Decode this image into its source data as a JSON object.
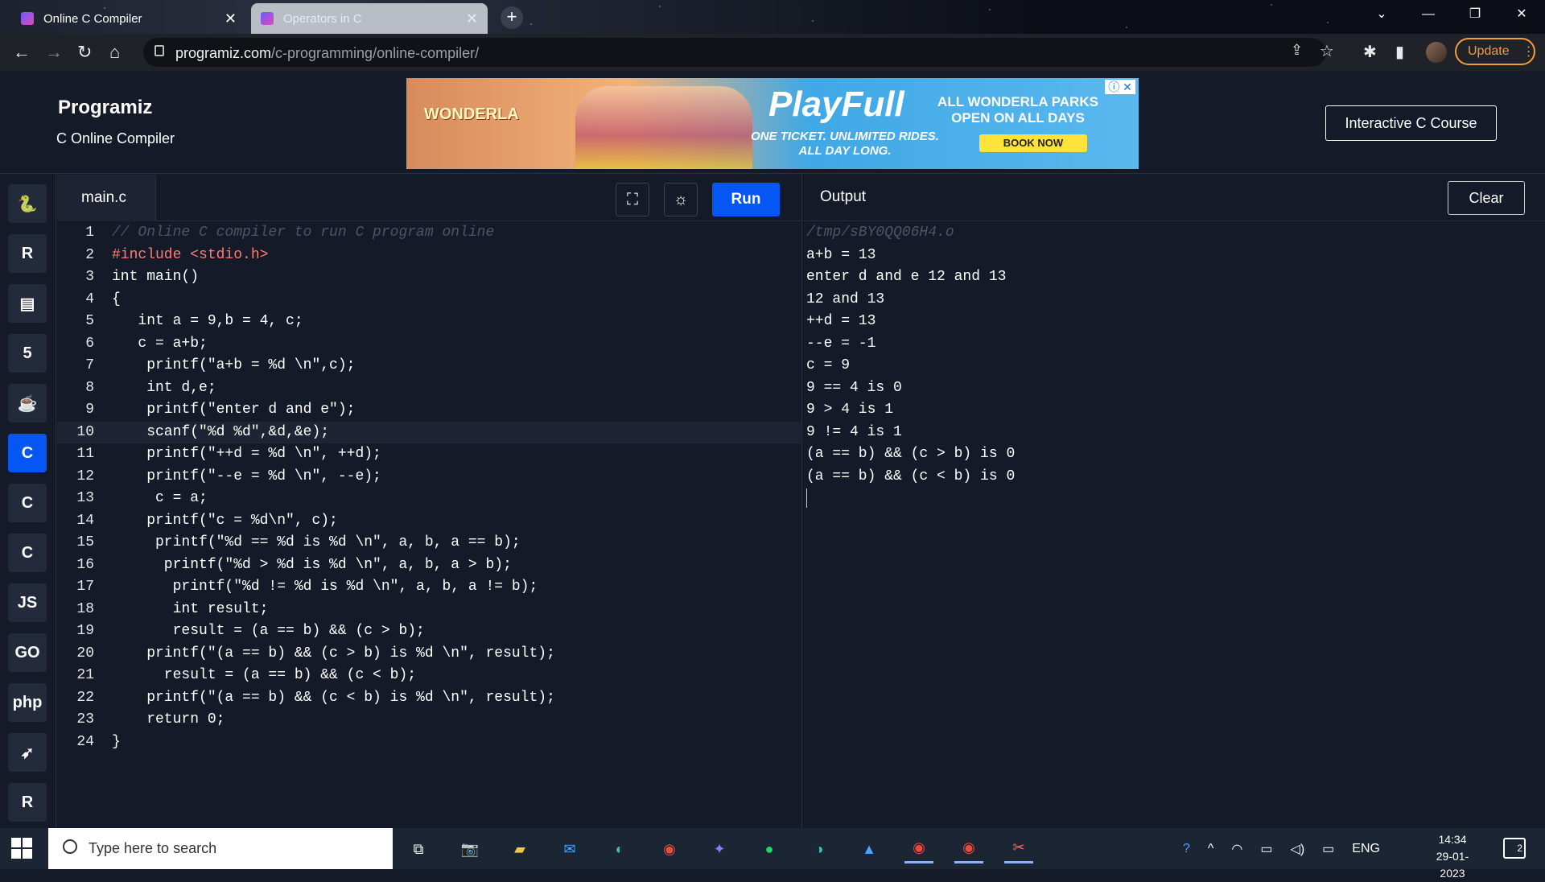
{
  "browser": {
    "tabs": [
      {
        "title": "Online C Compiler",
        "active": true
      },
      {
        "title": "Operators in C",
        "active": false
      }
    ],
    "url_domain": "programiz.com",
    "url_path": "/c-programming/online-compiler/",
    "update_label": "Update"
  },
  "header": {
    "logo": "Programiz",
    "subtitle": "C Online Compiler",
    "course_button": "Interactive C Course"
  },
  "ad": {
    "brand": "WONDERLA",
    "headline": "PlayFull",
    "line1": "ALL WONDERLA PARKS OPEN ON ALL DAYS",
    "line2": "ONE TICKET. UNLIMITED RIDES. ALL DAY LONG.",
    "cta": "BOOK NOW"
  },
  "sidebar": {
    "languages": [
      {
        "name": "python-icon",
        "glyph": "🐍"
      },
      {
        "name": "r-icon",
        "glyph": "R"
      },
      {
        "name": "sql-icon",
        "glyph": "▤"
      },
      {
        "name": "html-icon",
        "glyph": "5"
      },
      {
        "name": "java-icon",
        "glyph": "☕"
      },
      {
        "name": "c-icon",
        "glyph": "C",
        "active": true
      },
      {
        "name": "cpp-icon",
        "glyph": "C"
      },
      {
        "name": "csharp-icon",
        "glyph": "C"
      },
      {
        "name": "js-icon",
        "glyph": "JS"
      },
      {
        "name": "go-icon",
        "glyph": "GO"
      },
      {
        "name": "php-icon",
        "glyph": "php"
      },
      {
        "name": "swift-icon",
        "glyph": "➶"
      },
      {
        "name": "rust-icon",
        "glyph": "R"
      }
    ]
  },
  "editor": {
    "filename": "main.c",
    "run_label": "Run",
    "lines": [
      "// Online C compiler to run C program online",
      "#include <stdio.h>",
      "int main()",
      "{",
      "   int a = 9,b = 4, c;",
      "   c = a+b;",
      "    printf(\"a+b = %d \\n\",c);",
      "    int d,e;",
      "    printf(\"enter d and e\");",
      "    scanf(\"%d %d\",&d,&e);",
      "    printf(\"++d = %d \\n\", ++d);",
      "    printf(\"--e = %d \\n\", --e);",
      "     c = a;",
      "    printf(\"c = %d\\n\", c);",
      "     printf(\"%d == %d is %d \\n\", a, b, a == b);",
      "      printf(\"%d > %d is %d \\n\", a, b, a > b);",
      "       printf(\"%d != %d is %d \\n\", a, b, a != b);",
      "       int result;",
      "       result = (a == b) && (c > b);",
      "    printf(\"(a == b) && (c > b) is %d \\n\", result);",
      "      result = (a == b) && (c < b);",
      "    printf(\"(a == b) && (c < b) is %d \\n\", result);",
      "    return 0;",
      "}"
    ]
  },
  "output": {
    "title": "Output",
    "clear_label": "Clear",
    "lines": [
      "/tmp/sBY0QQ06H4.o",
      "a+b = 13",
      "enter d and e 12 and 13",
      "12 and 13",
      "++d = 13",
      "--e = -1",
      "c = 9",
      "9 == 4 is 0",
      "9 > 4 is 1",
      "9 != 4 is 1",
      "(a == b) && (c > b) is 0",
      "(a == b) && (c < b) is 0"
    ]
  },
  "taskbar": {
    "search_placeholder": "Type here to search",
    "language": "ENG",
    "time": "14:34",
    "date": "29-01-2023",
    "notifications": "2"
  }
}
